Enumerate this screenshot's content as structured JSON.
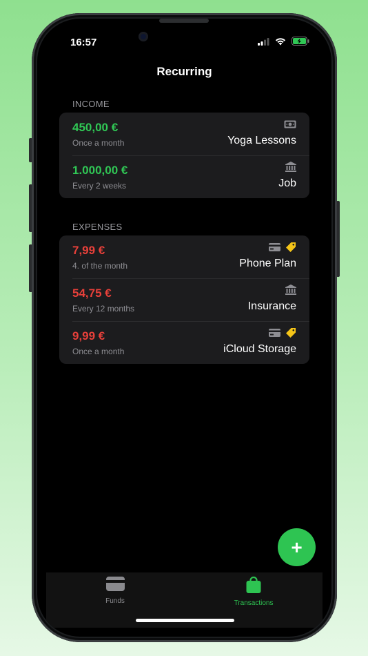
{
  "status_bar": {
    "time": "16:57"
  },
  "header": {
    "title": "Recurring"
  },
  "colors": {
    "income": "#30c755",
    "expense": "#e8403a",
    "accent": "#2ec452",
    "tag": "#f5c518"
  },
  "income": {
    "section_label": "INCOME",
    "items": [
      {
        "amount": "450,00 €",
        "frequency": "Once a month",
        "name": "Yoga Lessons",
        "icons": [
          "cash-icon"
        ]
      },
      {
        "amount": "1.000,00 €",
        "frequency": "Every 2 weeks",
        "name": "Job",
        "icons": [
          "bank-icon"
        ]
      }
    ]
  },
  "expenses": {
    "section_label": "EXPENSES",
    "items": [
      {
        "amount": "7,99 €",
        "frequency": "4. of the month",
        "name": "Phone Plan",
        "icons": [
          "credit-card-icon",
          "tag-icon"
        ]
      },
      {
        "amount": "54,75 €",
        "frequency": "Every 12 months",
        "name": "Insurance",
        "icons": [
          "bank-icon"
        ]
      },
      {
        "amount": "9,99 €",
        "frequency": "Once a month",
        "name": "iCloud Storage",
        "icons": [
          "credit-card-icon",
          "tag-icon"
        ]
      }
    ]
  },
  "fab": {
    "label": "+"
  },
  "tabbar": {
    "tabs": [
      {
        "label": "Funds",
        "icon": "wallet-icon",
        "active": false
      },
      {
        "label": "Transactions",
        "icon": "shopping-bag-icon",
        "active": true
      }
    ]
  }
}
